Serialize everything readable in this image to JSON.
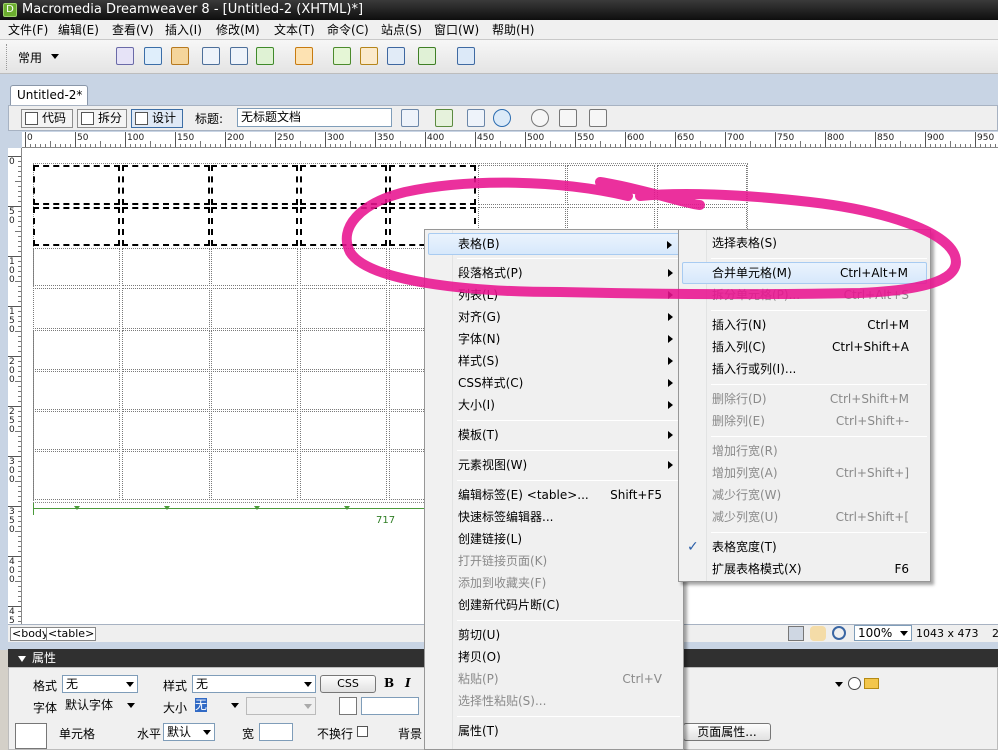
{
  "window": {
    "title": "Macromedia Dreamweaver 8 - [Untitled-2 (XHTML)*]"
  },
  "menubar": [
    "文件(F)",
    "编辑(E)",
    "查看(V)",
    "插入(I)",
    "修改(M)",
    "文本(T)",
    "命令(C)",
    "站点(S)",
    "窗口(W)",
    "帮助(H)"
  ],
  "insertbar": {
    "category": "常用"
  },
  "document": {
    "tab": "Untitled-2*",
    "views": {
      "code": "代码",
      "split": "拆分",
      "design": "设计"
    },
    "title_label": "标题:",
    "title_value": "无标题文档"
  },
  "ruler": {
    "h_labels": [
      "0",
      "50",
      "100",
      "150",
      "200",
      "250",
      "300",
      "350",
      "400",
      "450",
      "500",
      "550",
      "600",
      "650",
      "700",
      "750",
      "800",
      "850",
      "900",
      "950"
    ]
  },
  "table": {
    "width_label": "717"
  },
  "statusbar": {
    "tags": [
      "<body>",
      "<table>"
    ],
    "zoom": "100%",
    "size": "1043 x 473",
    "extra": "2"
  },
  "properties": {
    "header": "属性",
    "format_label": "格式",
    "format_value": "无",
    "style_label": "样式",
    "style_value": "无",
    "css_button": "CSS",
    "bold": "B",
    "italic": "I",
    "font_label": "字体",
    "font_value": "默认字体",
    "size_label": "大小",
    "size_value": "无",
    "cell_label": "单元格",
    "horz_label": "水平",
    "horz_value": "默认",
    "width_label": "宽",
    "nowrap_label": "不换行",
    "bg_label": "背景",
    "page_props_button": "页面属性..."
  },
  "context_menu": {
    "items": [
      {
        "label": "表格(B)",
        "submenu": true,
        "highlight": true
      },
      {
        "label": "段落格式(P)",
        "submenu": true
      },
      {
        "label": "列表(L)",
        "submenu": true
      },
      {
        "label": "对齐(G)",
        "submenu": true
      },
      {
        "label": "字体(N)",
        "submenu": true
      },
      {
        "label": "样式(S)",
        "submenu": true
      },
      {
        "label": "CSS样式(C)",
        "submenu": true
      },
      {
        "label": "大小(I)",
        "submenu": true
      },
      {
        "label": "模板(T)",
        "submenu": true
      },
      {
        "label": "元素视图(W)",
        "submenu": true
      },
      {
        "label": "编辑标签(E) <table>...",
        "shortcut": "Shift+F5"
      },
      {
        "label": "快速标签编辑器..."
      },
      {
        "label": "创建链接(L)"
      },
      {
        "label": "打开链接页面(K)",
        "disabled": true
      },
      {
        "label": "添加到收藏夹(F)",
        "disabled": true
      },
      {
        "label": "创建新代码片断(C)"
      },
      {
        "label": "剪切(U)"
      },
      {
        "label": "拷贝(O)"
      },
      {
        "label": "粘贴(P)",
        "shortcut": "Ctrl+V",
        "disabled": true
      },
      {
        "label": "选择性粘贴(S)...",
        "disabled": true
      },
      {
        "label": "属性(T)"
      }
    ]
  },
  "submenu": {
    "items": [
      {
        "label": "选择表格(S)"
      },
      {
        "label": "合并单元格(M)",
        "shortcut": "Ctrl+Alt+M",
        "highlight": true
      },
      {
        "label": "拆分单元格(P)...",
        "shortcut": "Ctrl+Alt+S",
        "disabled": true
      },
      {
        "label": "插入行(N)",
        "shortcut": "Ctrl+M"
      },
      {
        "label": "插入列(C)",
        "shortcut": "Ctrl+Shift+A"
      },
      {
        "label": "插入行或列(I)..."
      },
      {
        "label": "删除行(D)",
        "shortcut": "Ctrl+Shift+M",
        "disabled": true
      },
      {
        "label": "删除列(E)",
        "shortcut": "Ctrl+Shift+-",
        "disabled": true
      },
      {
        "label": "增加行宽(R)",
        "disabled": true
      },
      {
        "label": "增加列宽(A)",
        "shortcut": "Ctrl+Shift+]",
        "disabled": true
      },
      {
        "label": "减少行宽(W)",
        "disabled": true
      },
      {
        "label": "减少列宽(U)",
        "shortcut": "Ctrl+Shift+[",
        "disabled": true
      },
      {
        "label": "表格宽度(T)",
        "checked": true,
        "check": "✓"
      },
      {
        "label": "扩展表格模式(X)",
        "shortcut": "F6"
      }
    ]
  },
  "colors": {
    "annotation": "#e8138f",
    "menu_highlight": "#d7e8fb",
    "titlebar": "#1a1a1a"
  }
}
